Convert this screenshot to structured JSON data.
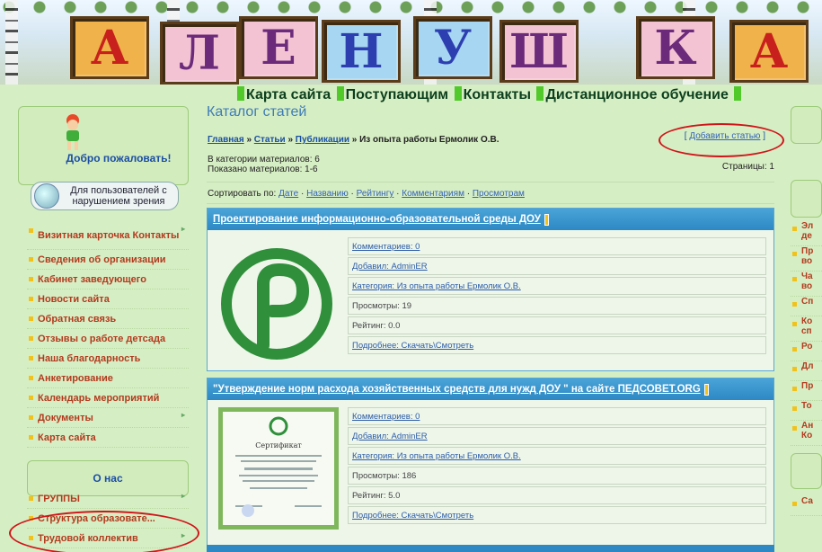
{
  "banner": {
    "letters": [
      "А",
      "Л",
      "Е",
      "Н",
      "У",
      "Ш",
      "К",
      "А"
    ]
  },
  "topnav": [
    "Карта сайта",
    "Поступающим",
    "Контакты",
    "Дистанционное обучение"
  ],
  "left": {
    "welcome": "Добро пожаловать!",
    "vision": "Для пользователей с нарушением зрения",
    "menu": [
      "Визитная карточка Контакты",
      "Сведения об организации",
      "Кабинет заведующего",
      "Новости сайта",
      "Обратная связь",
      "Отзывы о работе детсада",
      "Наша благодарность",
      "Анкетирование",
      "Календарь мероприятий",
      "Документы",
      "Карта сайта"
    ],
    "about": "О нас",
    "menu2": [
      "ГРУППЫ",
      "Структура образовате...",
      "Трудовой коллектив"
    ]
  },
  "catalog": {
    "title": "Каталог статей",
    "breadcrumb": [
      "Главная",
      "Статьи",
      "Публикации"
    ],
    "breadcrumb_sep": "»",
    "breadcrumb_current": "Из опыта работы Ермолик О.В.",
    "add_article": "Добавить статью",
    "count_line1": "В категории материалов: 6",
    "count_line2": "Показано материалов: 1-6",
    "pages": "Страницы: 1",
    "sort_label": "Сортировать по:",
    "sort_options": [
      "Дате",
      "Названию",
      "Рейтингу",
      "Комментариям",
      "Просмотрам"
    ]
  },
  "entries": [
    {
      "title": "Проектирование информационно-образовательной среды ДОУ",
      "comments": "Комментариев: 0",
      "added": "Добавил: AdminER",
      "category": "Категория: Из опыта работы Ермолик О.В.",
      "views": "Просмотры: 19",
      "rating": "Рейтинг: 0.0",
      "more": "Подробнее: Скачать\\Смотреть"
    },
    {
      "title": "\"Утверждение норм расхода хозяйственных средств для нужд ДОУ \" на сайте ПЕДСОВЕТ.ORG",
      "comments": "Комментариев: 0",
      "added": "Добавил: AdminER",
      "category": "Категория: Из опыта работы Ермолик О.В.",
      "views": "Просмотры: 186",
      "rating": "Рейтинг: 5.0",
      "more": "Подробнее: Скачать\\Смотреть",
      "cert_title": "Сертификат"
    }
  ],
  "right": [
    "Эл де",
    "Пр во",
    "Ча во",
    "Сп",
    "Ко сп",
    "Ро",
    "Дл",
    "Пр",
    "То",
    "Ан Ко",
    "Са"
  ],
  "colors": {
    "accent": "#2d88c4",
    "menu_text": "#b33a1e",
    "annotation": "#d0151a"
  }
}
